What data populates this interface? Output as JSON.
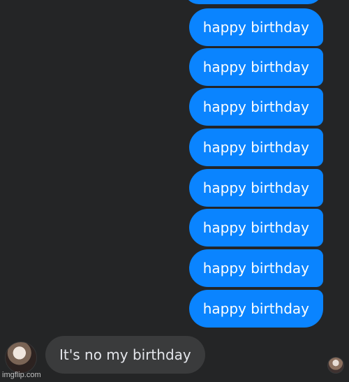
{
  "chat": {
    "outgoing_messages": [
      "happy birthday",
      "happy birthday",
      "happy birthday",
      "happy birthday",
      "happy birthday",
      "happy birthday",
      "happy birthday",
      "happy birthday"
    ],
    "incoming_message": "It's no my birthday"
  },
  "watermark": "imgflip.com",
  "colors": {
    "background": "#242526",
    "outgoing_bubble": "#0a84ff",
    "incoming_bubble": "#3a3b3c",
    "incoming_text": "#e4e6eb"
  },
  "icons": {
    "sender_avatar": "profile-avatar-icon",
    "seen_avatar": "seen-receipt-avatar-icon"
  }
}
